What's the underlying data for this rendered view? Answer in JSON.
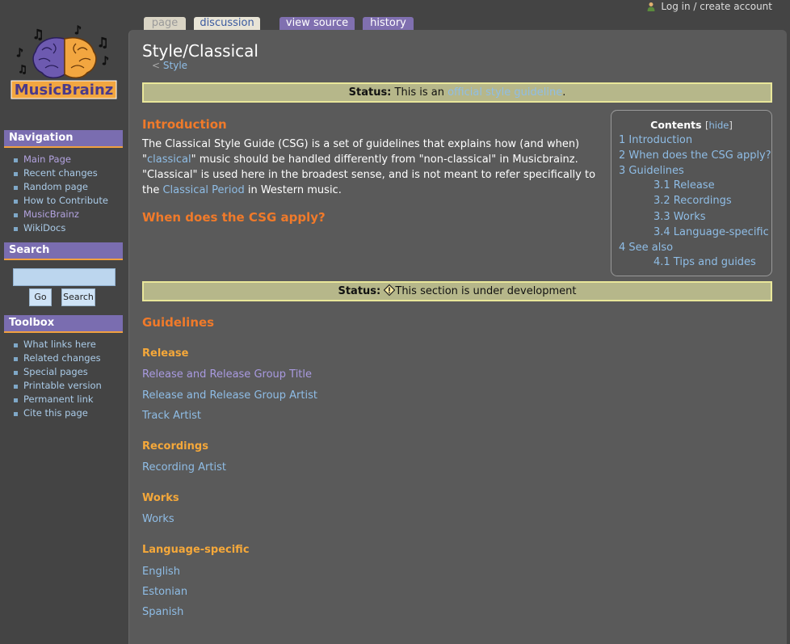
{
  "personal": {
    "login_label": "Log in / create account",
    "icon": "user-icon"
  },
  "tabs": {
    "page": "page",
    "discussion": "discussion",
    "view_source": "view source",
    "history": "history"
  },
  "logo": {
    "text": "MusicBrainz"
  },
  "navigation": {
    "title": "Navigation",
    "items": [
      "Main Page",
      "Recent changes",
      "Random page",
      "How to Contribute",
      "MusicBrainz",
      "WikiDocs"
    ]
  },
  "search": {
    "title": "Search",
    "go_label": "Go",
    "search_label": "Search",
    "value": ""
  },
  "toolbox": {
    "title": "Toolbox",
    "items": [
      "What links here",
      "Related changes",
      "Special pages",
      "Printable version",
      "Permanent link",
      "Cite this page"
    ]
  },
  "page": {
    "title": "Style/Classical",
    "breadcrumb_prefix": "<",
    "breadcrumb_link": "Style",
    "status1": {
      "label": "Status:",
      "text": "This is an",
      "link": "official style guideline",
      "end": "."
    },
    "intro_heading": "Introduction",
    "intro_p1": "The Classical Style Guide (CSG) is a set of guidelines that explains how (and when)",
    "intro_q_open": "\"",
    "intro_link1": "classical",
    "intro_p2": "\" music should be handled differently from \"non-classical\" in Musicbrainz.",
    "intro_p3": "\"Classical\" is used here in the broadest sense, and is not meant to refer specifically to",
    "intro_p4a": "the",
    "intro_link2": "Classical Period",
    "intro_p4b": "in Western music.",
    "when_heading": "When does the CSG apply?",
    "status2": {
      "label": "Status:",
      "text": "This section is under development"
    },
    "guidelines_heading": "Guidelines",
    "release_heading": "Release",
    "release_links": [
      "Release and Release Group Title",
      "Release and Release Group Artist",
      "Track Artist"
    ],
    "recordings_heading": "Recordings",
    "recordings_links": [
      "Recording Artist"
    ],
    "works_heading": "Works",
    "works_links": [
      "Works"
    ],
    "language_heading": "Language-specific",
    "language_links": [
      "English",
      "Estonian",
      "Spanish"
    ]
  },
  "toc": {
    "title": "Contents",
    "hide_open": "[",
    "hide_label": "hide",
    "hide_close": "]",
    "items": [
      "1 Introduction",
      "2 When does the CSG apply?",
      "3 Guidelines",
      "3.1 Release",
      "3.2 Recordings",
      "3.3 Works",
      "3.4 Language-specific",
      "4 See also",
      "4.1 Tips and guides"
    ]
  },
  "colors": {
    "accent_purple": "#7a6db0",
    "accent_orange": "#f07a2a",
    "link": "#8fbde6",
    "status_bg": "#b6b78a"
  }
}
